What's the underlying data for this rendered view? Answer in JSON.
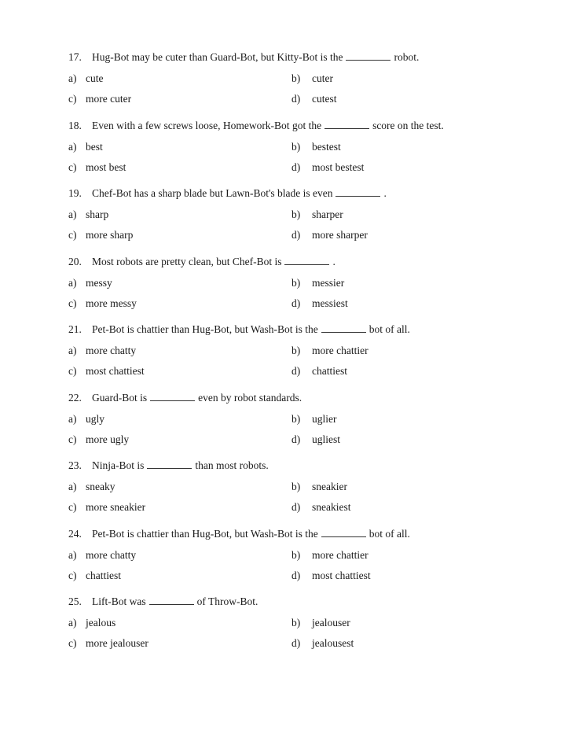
{
  "questions": [
    {
      "number": "17.",
      "before": "Hug-Bot may be cuter than Guard-Bot, but Kitty-Bot is the",
      "after": "robot.",
      "options": [
        {
          "letter": "a)",
          "text": "cute"
        },
        {
          "letter": "b)",
          "text": "cuter"
        },
        {
          "letter": "c)",
          "text": "more cuter"
        },
        {
          "letter": "d)",
          "text": "cutest"
        }
      ]
    },
    {
      "number": "18.",
      "before": "Even with a few screws loose, Homework-Bot got the",
      "after": "score on the test.",
      "options": [
        {
          "letter": "a)",
          "text": "best"
        },
        {
          "letter": "b)",
          "text": "bestest"
        },
        {
          "letter": "c)",
          "text": "most best"
        },
        {
          "letter": "d)",
          "text": "most bestest"
        }
      ]
    },
    {
      "number": "19.",
      "before": "Chef-Bot has a sharp blade but Lawn-Bot's blade is even",
      "after": ".",
      "options": [
        {
          "letter": "a)",
          "text": "sharp"
        },
        {
          "letter": "b)",
          "text": "sharper"
        },
        {
          "letter": "c)",
          "text": "more sharp"
        },
        {
          "letter": "d)",
          "text": "more sharper"
        }
      ]
    },
    {
      "number": "20.",
      "before": "Most robots are pretty clean, but Chef-Bot is",
      "after": ".",
      "options": [
        {
          "letter": "a)",
          "text": "messy"
        },
        {
          "letter": "b)",
          "text": "messier"
        },
        {
          "letter": "c)",
          "text": "more messy"
        },
        {
          "letter": "d)",
          "text": "messiest"
        }
      ]
    },
    {
      "number": "21.",
      "before": "Pet-Bot is chattier than Hug-Bot, but Wash-Bot is the",
      "after": "bot of all.",
      "options": [
        {
          "letter": "a)",
          "text": "more chatty"
        },
        {
          "letter": "b)",
          "text": "more chattier"
        },
        {
          "letter": "c)",
          "text": "most chattiest"
        },
        {
          "letter": "d)",
          "text": "chattiest"
        }
      ]
    },
    {
      "number": "22.",
      "before": "Guard-Bot is",
      "after": "even by robot standards.",
      "options": [
        {
          "letter": "a)",
          "text": "ugly"
        },
        {
          "letter": "b)",
          "text": "uglier"
        },
        {
          "letter": "c)",
          "text": "more ugly"
        },
        {
          "letter": "d)",
          "text": "ugliest"
        }
      ]
    },
    {
      "number": "23.",
      "before": "Ninja-Bot is",
      "after": "than most robots.",
      "options": [
        {
          "letter": "a)",
          "text": "sneaky"
        },
        {
          "letter": "b)",
          "text": "sneakier"
        },
        {
          "letter": "c)",
          "text": "more sneakier"
        },
        {
          "letter": "d)",
          "text": "sneakiest"
        }
      ]
    },
    {
      "number": "24.",
      "before": "Pet-Bot is chattier than Hug-Bot, but Wash-Bot is the",
      "after": "bot of all.",
      "options": [
        {
          "letter": "a)",
          "text": "more chatty"
        },
        {
          "letter": "b)",
          "text": "more chattier"
        },
        {
          "letter": "c)",
          "text": "chattiest"
        },
        {
          "letter": "d)",
          "text": "most chattiest"
        }
      ]
    },
    {
      "number": "25.",
      "before": "Lift-Bot was",
      "after": "of Throw-Bot.",
      "options": [
        {
          "letter": "a)",
          "text": "jealous"
        },
        {
          "letter": "b)",
          "text": "jealouser"
        },
        {
          "letter": "c)",
          "text": "more jealouser"
        },
        {
          "letter": "d)",
          "text": "jealousest"
        }
      ]
    }
  ]
}
